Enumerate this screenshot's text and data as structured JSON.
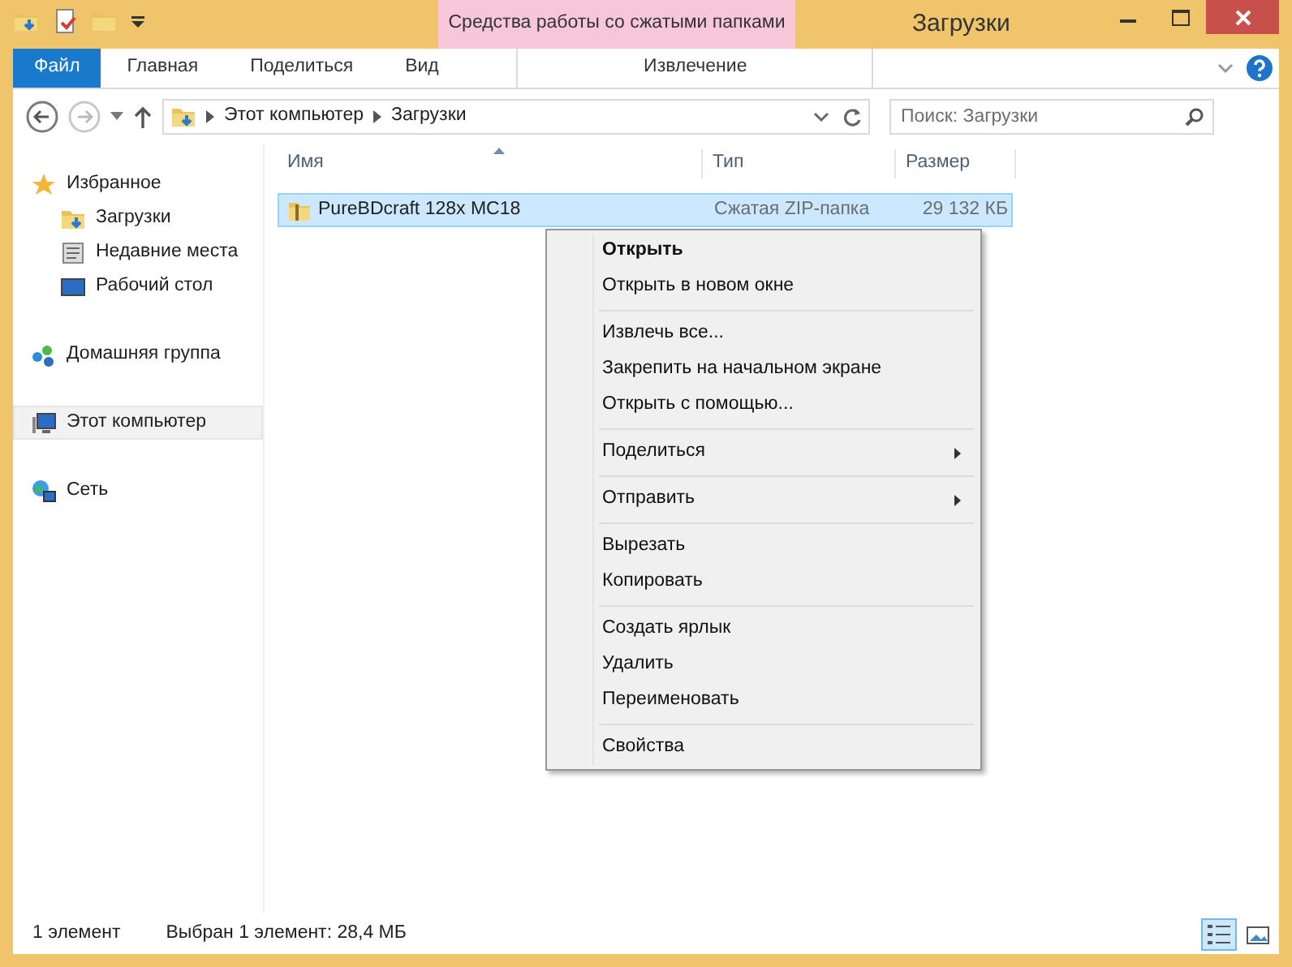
{
  "title_bar": {
    "context_tab": "Средства работы со сжатыми папками",
    "title": "Загрузки"
  },
  "ribbon_tabs": [
    {
      "label": "Файл",
      "kind": "file",
      "selected": false
    },
    {
      "label": "Главная",
      "kind": "tab",
      "selected": false
    },
    {
      "label": "Поделиться",
      "kind": "tab",
      "selected": false
    },
    {
      "label": "Вид",
      "kind": "tab",
      "selected": false
    },
    {
      "label": "Извлечение",
      "kind": "context",
      "selected": false
    }
  ],
  "address": {
    "crumbs": [
      "Этот компьютер",
      "Загрузки"
    ],
    "search_placeholder": "Поиск: Загрузки"
  },
  "navigation": [
    {
      "label": "Избранное",
      "kind": "favorites",
      "selected": false,
      "children": [
        {
          "label": "Загрузки",
          "kind": "downloads",
          "selected": false
        },
        {
          "label": "Недавние места",
          "kind": "recent",
          "selected": false
        },
        {
          "label": "Рабочий стол",
          "kind": "desktop",
          "selected": false
        }
      ]
    },
    {
      "label": "Домашняя группа",
      "kind": "homegroup",
      "selected": false
    },
    {
      "label": "Этот компьютер",
      "kind": "computer",
      "selected": true
    },
    {
      "label": "Сеть",
      "kind": "network",
      "selected": false
    }
  ],
  "columns": [
    "Имя",
    "Тип",
    "Размер"
  ],
  "files": [
    {
      "name": "PureBDcraft 128x MC18",
      "type": "Сжатая ZIP-папка",
      "size": "29 132 КБ",
      "selected": true
    }
  ],
  "context_menu": [
    [
      {
        "label": "Открыть",
        "default": true,
        "submenu": false
      },
      {
        "label": "Открыть в новом окне",
        "default": false,
        "submenu": false
      }
    ],
    [
      {
        "label": "Извлечь все...",
        "default": false,
        "submenu": false
      },
      {
        "label": "Закрепить на начальном экране",
        "default": false,
        "submenu": false
      },
      {
        "label": "Открыть с помощью...",
        "default": false,
        "submenu": false
      }
    ],
    [
      {
        "label": "Поделиться",
        "default": false,
        "submenu": true
      }
    ],
    [
      {
        "label": "Отправить",
        "default": false,
        "submenu": true
      }
    ],
    [
      {
        "label": "Вырезать",
        "default": false,
        "submenu": false
      },
      {
        "label": "Копировать",
        "default": false,
        "submenu": false
      }
    ],
    [
      {
        "label": "Создать ярлык",
        "default": false,
        "submenu": false
      },
      {
        "label": "Удалить",
        "default": false,
        "submenu": false
      },
      {
        "label": "Переименовать",
        "default": false,
        "submenu": false
      }
    ],
    [
      {
        "label": "Свойства",
        "default": false,
        "submenu": false
      }
    ]
  ],
  "status_bar": {
    "count": "1 элемент",
    "selection": "Выбран 1 элемент: 28,4 МБ"
  },
  "view_buttons": [
    {
      "kind": "details",
      "selected": true
    },
    {
      "kind": "large_icons",
      "selected": false
    }
  ]
}
